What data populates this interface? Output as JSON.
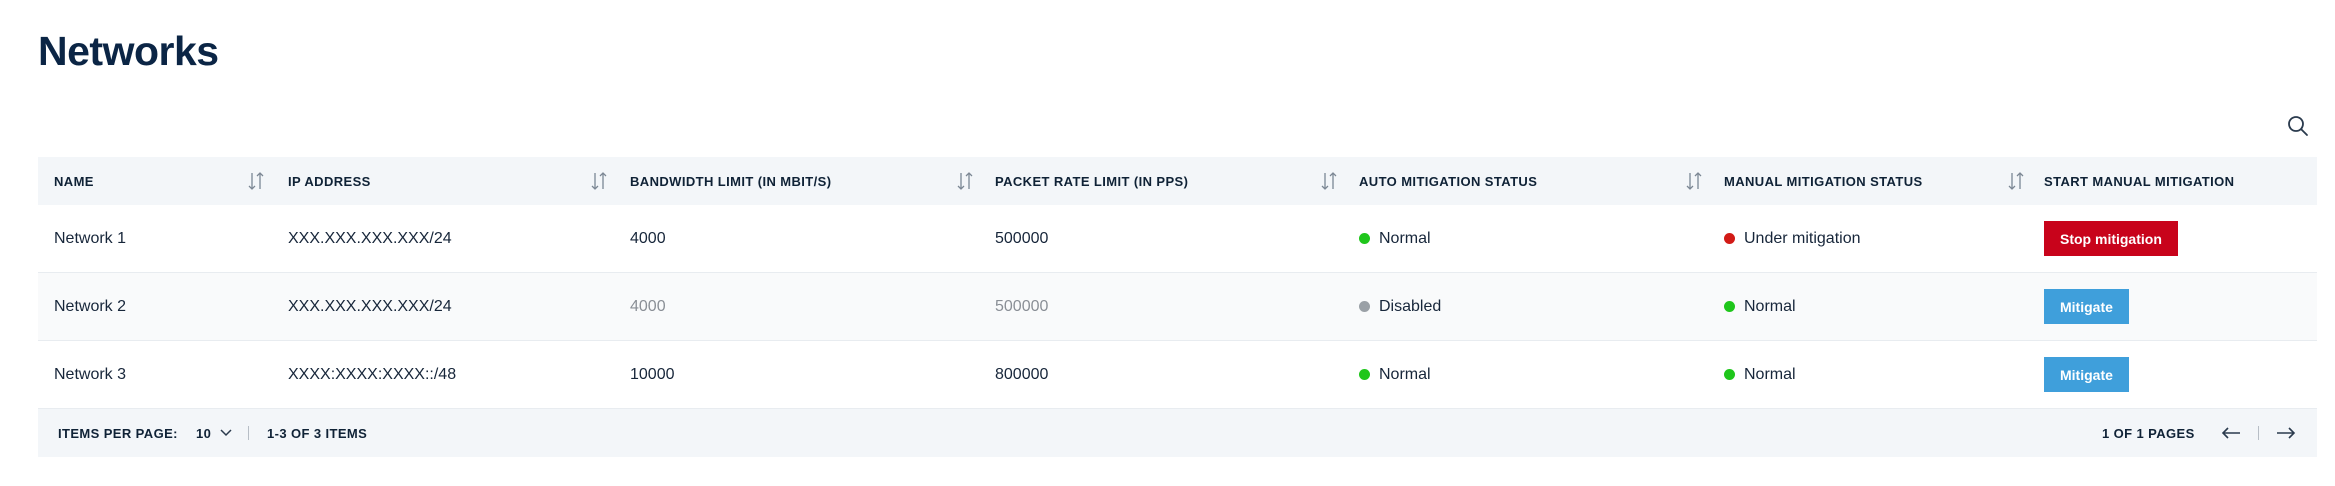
{
  "page": {
    "title": "Networks"
  },
  "colors": {
    "danger": "#c8031b",
    "primary": "#3f9fdb",
    "status_green": "#1fc61b",
    "status_red": "#d21a16",
    "status_grey": "#9aa0a6"
  },
  "table": {
    "columns": [
      {
        "label": "NAME",
        "sortable": true
      },
      {
        "label": "IP ADDRESS",
        "sortable": true
      },
      {
        "label": "BANDWIDTH LIMIT (IN MBIT/S)",
        "sortable": true
      },
      {
        "label": "PACKET RATE LIMIT (IN PPS)",
        "sortable": true
      },
      {
        "label": "AUTO MITIGATION STATUS",
        "sortable": true
      },
      {
        "label": "MANUAL MITIGATION STATUS",
        "sortable": true
      },
      {
        "label": "START MANUAL MITIGATION",
        "sortable": false
      }
    ],
    "rows": [
      {
        "name": "Network 1",
        "ip": "XXX.XXX.XXX.XXX/24",
        "bandwidth": "4000",
        "packet_rate": "500000",
        "auto_status": "Normal",
        "auto_color": "green",
        "manual_status": "Under mitigation",
        "manual_color": "red",
        "action": "Stop mitigation",
        "action_style": "danger"
      },
      {
        "name": "Network 2",
        "ip": "XXX.XXX.XXX.XXX/24",
        "bandwidth": "4000",
        "packet_rate": "500000",
        "auto_status": "Disabled",
        "auto_color": "grey",
        "manual_status": "Normal",
        "manual_color": "green",
        "action": "Mitigate",
        "action_style": "primary"
      },
      {
        "name": "Network 3",
        "ip": "XXXX:XXXX:XXXX::/48",
        "bandwidth": "10000",
        "packet_rate": "800000",
        "auto_status": "Normal",
        "auto_color": "green",
        "manual_status": "Normal",
        "manual_color": "green",
        "action": "Mitigate",
        "action_style": "primary"
      }
    ]
  },
  "pagination": {
    "items_per_page_label": "ITEMS PER PAGE:",
    "items_per_page_value": "10",
    "range_label": "1-3 OF 3 ITEMS",
    "pages_label": "1 OF 1 PAGES"
  },
  "icons": {
    "search": "search-icon",
    "sort": "sort-icon",
    "chevron": "chevron-down-icon",
    "prev": "arrow-left-icon",
    "next": "arrow-right-icon"
  }
}
